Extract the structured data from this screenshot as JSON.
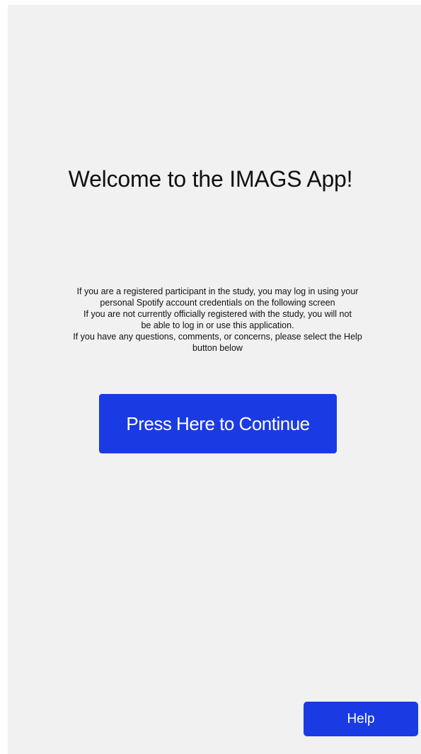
{
  "welcome": {
    "title": "Welcome to the IMAGS App!"
  },
  "info": {
    "lines": [
      "If you are a registered participant in the study, you may log in using your",
      "personal Spotify account credentials on the following screen",
      "If you are not currently officially registered with the study, you will not",
      "be able to log in or use this application.",
      "If you have any questions, comments, or concerns, please select the Help",
      "button below"
    ]
  },
  "buttons": {
    "continue_label": "Press Here to Continue",
    "help_label": "Help"
  },
  "colors": {
    "background": "#f1f1f1",
    "button": "#1a3be3",
    "button_text": "#ffffff",
    "text": "#111111"
  }
}
